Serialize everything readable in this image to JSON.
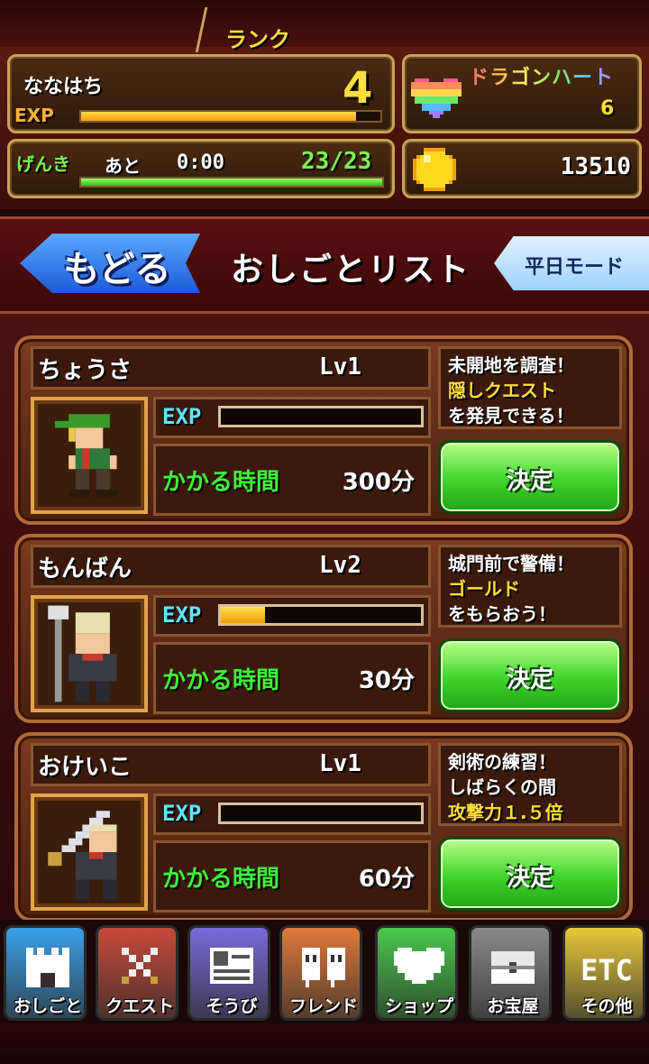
{
  "player": {
    "name": "ななはち",
    "rank_label": "ランク",
    "rank": "4",
    "exp_label": "EXP",
    "exp_progress_pct": 92
  },
  "stamina": {
    "label": "げんき",
    "remaining_label": "あと",
    "timer": "0:00",
    "count": "23/23",
    "progress_pct": 100
  },
  "dragon_heart": {
    "label": "ドラゴンハート",
    "value": "6"
  },
  "gold": {
    "value": "13510"
  },
  "header": {
    "back_label": "もどる",
    "title": "おしごとリスト",
    "mode_label": "平日モード"
  },
  "jobs": [
    {
      "name": "ちょうさ",
      "level": "Lv1",
      "exp_label": "EXP",
      "exp_progress_pct": 0,
      "time_label": "かかる時間",
      "time_value": "300分",
      "desc": [
        "未開地を調査！",
        "隠しクエスト",
        "を発見できる！"
      ],
      "decide_label": "決定"
    },
    {
      "name": "もんばん",
      "level": "Lv2",
      "exp_label": "EXP",
      "exp_progress_pct": 22,
      "time_label": "かかる時間",
      "time_value": "30分",
      "desc": [
        "城門前で警備！",
        "ゴールド",
        "をもらおう！"
      ],
      "decide_label": "決定"
    },
    {
      "name": "おけいこ",
      "level": "Lv1",
      "exp_label": "EXP",
      "exp_progress_pct": 0,
      "time_label": "かかる時間",
      "time_value": "60分",
      "desc": [
        "剣術の練習！",
        "しばらくの間",
        "攻撃力１.５倍"
      ],
      "decide_label": "決定"
    }
  ],
  "nav": [
    {
      "label": "おしごと",
      "icon": "castle-icon",
      "color": "#3aa0e8"
    },
    {
      "label": "クエスト",
      "icon": "crossed-swords-icon",
      "color": "#c84a3a"
    },
    {
      "label": "そうび",
      "icon": "equipment-card-icon",
      "color": "#7a6ad8"
    },
    {
      "label": "フレンド",
      "icon": "friends-icon",
      "color": "#e07a3a"
    },
    {
      "label": "ショップ",
      "icon": "heart-icon",
      "color": "#4ac84a"
    },
    {
      "label": "お宝屋",
      "icon": "treasure-chest-icon",
      "color": "#8a8a8a"
    },
    {
      "label": "その他",
      "icon": "etc-icon",
      "color": "#e8c83a"
    }
  ]
}
